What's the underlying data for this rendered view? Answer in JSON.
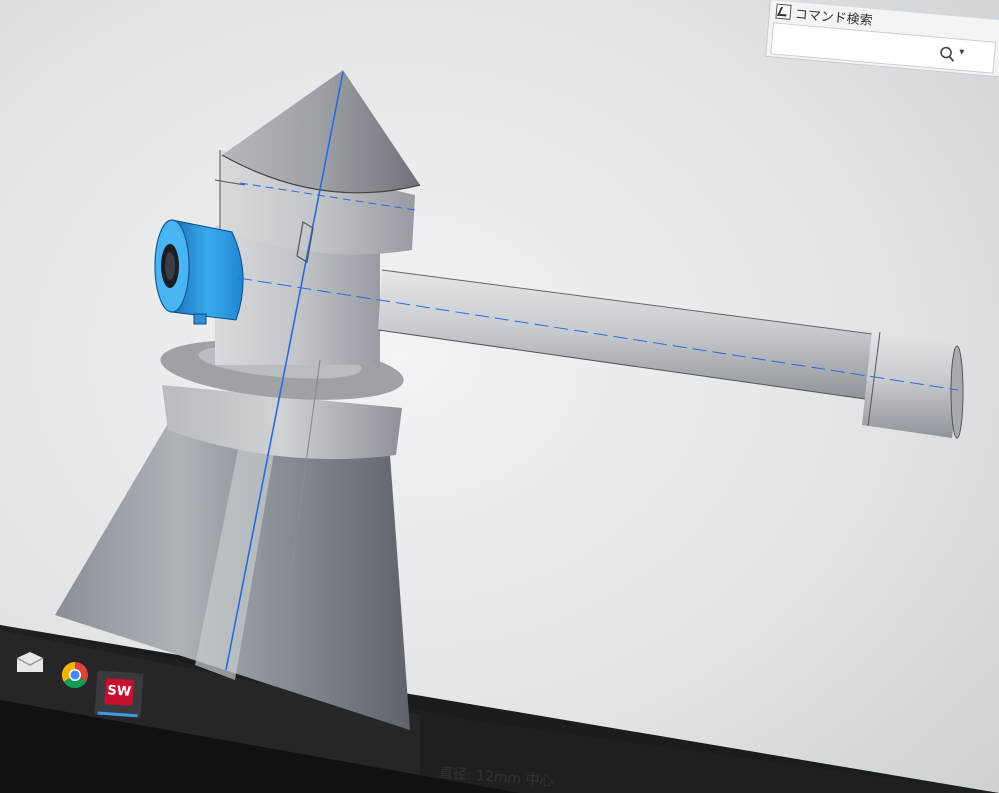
{
  "app": {
    "name": "SOLIDWORKS",
    "accent": "#c8102e",
    "viewport_bg": "#e6e8ea"
  },
  "command_search": {
    "label": "コマンド検索",
    "icon": "search-icon",
    "dropdown_icon": "chevron-down-icon"
  },
  "model": {
    "selected_face_color": "#2ea6ee",
    "body_color": "#c9ccd1",
    "sketch_line_color": "#2a6be0"
  },
  "taskbar": {
    "items": [
      {
        "name": "mail",
        "icon": "mail-icon"
      },
      {
        "name": "chrome",
        "icon": "chrome-icon"
      },
      {
        "name": "solidworks",
        "icon": "solidworks-icon",
        "badge": "SW",
        "active": true
      }
    ]
  },
  "status_bar": {
    "text": "直径: 12mm  中心"
  }
}
